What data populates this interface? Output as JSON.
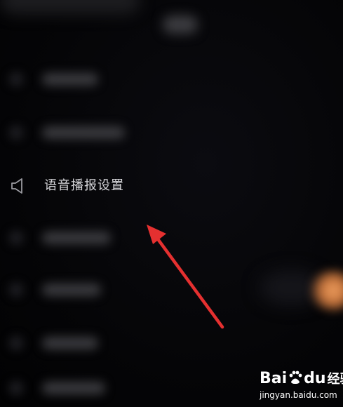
{
  "menu": {
    "voice_broadcast_settings": {
      "label": "语音播报设置",
      "icon": "speaker-icon"
    }
  },
  "annotation": {
    "arrow_color": "#e53030"
  },
  "watermark": {
    "brand_bai": "Bai",
    "brand_du": "du",
    "brand_jingyan": "经验",
    "url": "jingyan.baidu.com"
  },
  "colors": {
    "background": "#000000",
    "label_text": "#d8d8dc",
    "icon_stroke": "#9a9aa0",
    "glow": "#f0a060"
  }
}
